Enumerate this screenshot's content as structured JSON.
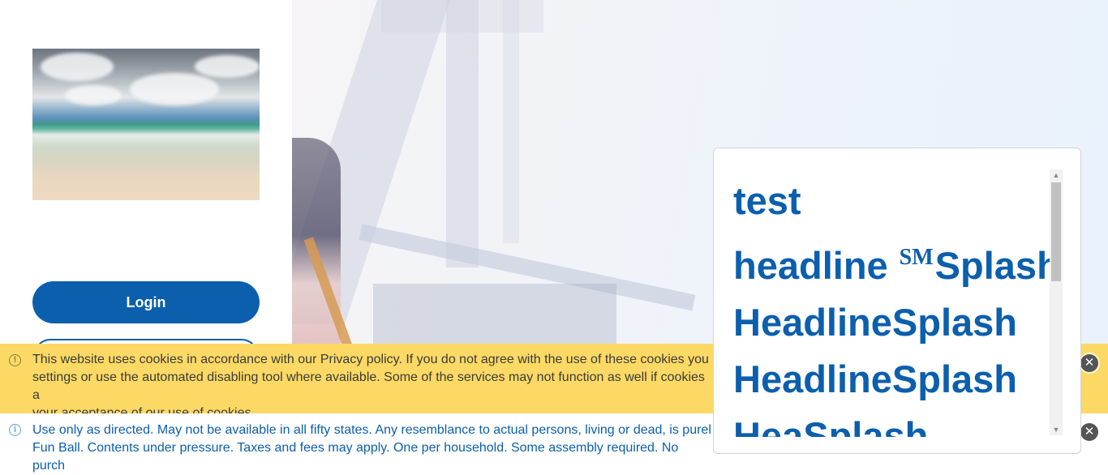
{
  "sidebar": {
    "login_label": "Login",
    "secondary_button_label": ""
  },
  "cookie_banner": {
    "message": "This website uses cookies in accordance with our Privacy policy. If you do not agree with the use of these cookies you\nsettings or use the automated disabling tool where available. Some of the services may not function as well if cookies a\nyour acceptance of our use of cookies",
    "icon": "warning-icon",
    "close_icon": "close-icon"
  },
  "disclaimer": {
    "message": "Use only as directed. May not be available in all fifty states. Any resemblance to actual persons, living or dead, is purel\nFun Ball. Contents under pressure. Taxes and fees may apply. One per household. Some assembly required. No purch",
    "icon": "info-icon",
    "close_icon": "close-icon"
  },
  "popup": {
    "lines": {
      "l1": "test",
      "l2_a": "headline",
      "l2_sm": "SM",
      "l2_b": "Splash",
      "l3": "HeadlineSplash",
      "l4": "HeadlineSplash",
      "l5": "HeaSplash"
    }
  },
  "colors": {
    "brand_blue": "#0b5fad",
    "banner_yellow": "#fcd964"
  }
}
